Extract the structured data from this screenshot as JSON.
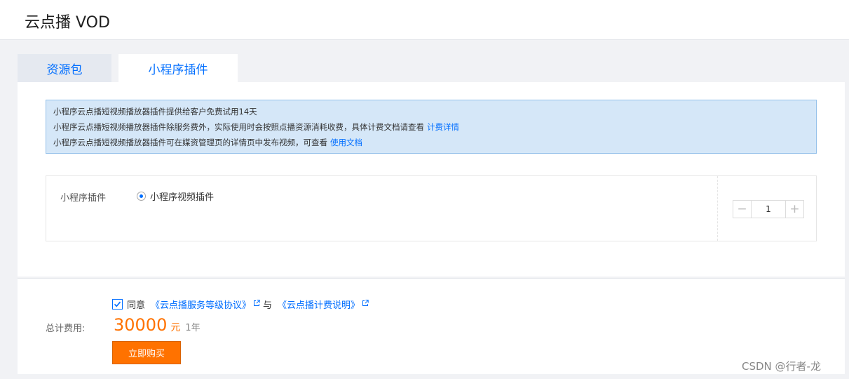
{
  "header": {
    "title": "云点播 VOD"
  },
  "tabs": [
    {
      "label": "资源包"
    },
    {
      "label": "小程序插件"
    }
  ],
  "notice": {
    "line1": "小程序云点播短视频播放器插件提供给客户免费试用14天",
    "line2": "小程序云点播短视频播放器插件除服务费外，实际使用时会按照点播资源消耗收费，具体计费文档请查看",
    "line2_link": "计费详情",
    "line3": "小程序云点播短视频播放器插件可在媒资管理页的详情页中发布视频，可查看",
    "line3_link": "使用文档"
  },
  "config": {
    "label": "小程序插件",
    "option_label": "小程序视频插件",
    "quantity": "1",
    "minus_symbol": "−",
    "plus_symbol": "+"
  },
  "footer": {
    "agree_text": "同意",
    "doc1": "《云点播服务等级协议》",
    "and_text": "与",
    "doc2": "《云点播计费说明》",
    "total_label": "总计费用:",
    "price": "30000",
    "currency": "元",
    "period": "1年",
    "buy_label": "立即购买"
  },
  "watermark": "CSDN @行者-龙",
  "colors": {
    "accent": "#006eff",
    "price": "#ff7200",
    "notice_bg": "#d5e7f8",
    "notice_border": "#93c0ea",
    "page_bg": "#f1f2f5"
  }
}
